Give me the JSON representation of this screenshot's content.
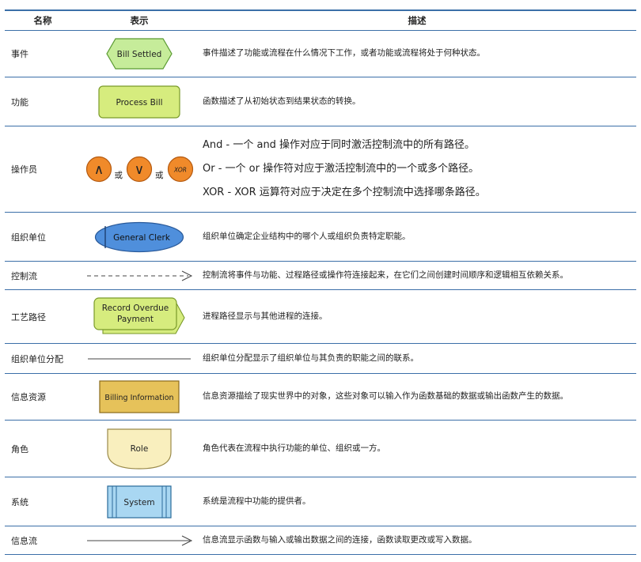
{
  "header": {
    "name": "名称",
    "symbol": "表示",
    "desc": "描述"
  },
  "colors": {
    "event": "#c6ec9a",
    "event_stroke": "#5a9a32",
    "function": "#d6ec7e",
    "function_stroke": "#7a9a2a",
    "operator": "#f08a2a",
    "operator_stroke": "#b55a10",
    "org": "#4f8fdc",
    "org_stroke": "#2a5a9a",
    "path": "#d6ec7e",
    "path_stroke": "#7a9a2a",
    "info": "#e6c25a",
    "info_stroke": "#8a6a1a",
    "role": "#f9efbe",
    "role_stroke": "#9a8a4a",
    "system": "#a9d7f2",
    "system_stroke": "#2a6a9a",
    "border": "#3b6fa8"
  },
  "rows": [
    {
      "name": "事件",
      "label": "Bill Settled",
      "desc": "事件描述了功能或流程在什么情况下工作，或者功能或流程将处于何种状态。"
    },
    {
      "name": "功能",
      "label": "Process Bill",
      "desc": "函数描述了从初始状态到结果状态的转换。"
    },
    {
      "name": "操作员",
      "op_and": "∧",
      "op_or": "∨",
      "op_xor": "XOR",
      "or_text": "或",
      "desc_lines": [
        "And - 一个 and 操作对应于同时激活控制流中的所有路径。",
        "Or - 一个 or 操作符对应于激活控制流中的一个或多个路径。",
        "XOR - XOR 运算符对应于决定在多个控制流中选择哪条路径。"
      ]
    },
    {
      "name": "组织单位",
      "label": "General Clerk",
      "desc": "组织单位确定企业结构中的哪个人或组织负责特定职能。"
    },
    {
      "name": "控制流",
      "desc": "控制流将事件与功能、过程路径或操作符连接起来，在它们之间创建时间顺序和逻辑相互依赖关系。"
    },
    {
      "name": "工艺路径",
      "label_line1": "Record Overdue",
      "label_line2": "Payment",
      "desc": "进程路径显示与其他进程的连接。"
    },
    {
      "name": "组织单位分配",
      "desc": "组织单位分配显示了组织单位与其负责的职能之间的联系。"
    },
    {
      "name": "信息资源",
      "label": "Billing Information",
      "desc": "信息资源描绘了现实世界中的对象，这些对象可以输入作为函数基础的数据或输出函数产生的数据。"
    },
    {
      "name": "角色",
      "label": "Role",
      "desc": "角色代表在流程中执行功能的单位、组织或一方。"
    },
    {
      "name": "系统",
      "label": "System",
      "desc": "系统是流程中功能的提供者。"
    },
    {
      "name": "信息流",
      "desc": "信息流显示函数与输入或输出数据之间的连接，函数读取更改或写入数据。"
    }
  ]
}
